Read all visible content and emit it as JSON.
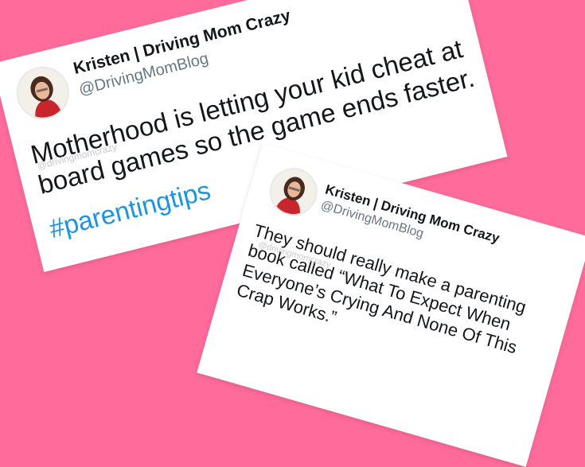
{
  "background_color": "#ff6b9b",
  "tweets": [
    {
      "display_name": "Kristen | Driving Mom Crazy",
      "handle": "@DrivingMomBlog",
      "text_line1": "Motherhood is letting your kid cheat at",
      "text_line2": "board games so the game ends faster.",
      "hashtag": "#parentingtips",
      "watermark": "@drivingmomcrazy",
      "avatar_icon": "woman-red-shirt-avatar"
    },
    {
      "display_name": "Kristen | Driving Mom Crazy",
      "handle": "@DrivingMomBlog",
      "text_line1": "They should really make a parenting",
      "text_line2": "book called “What To Expect When",
      "text_line3": "Everyone’s Crying And None Of This",
      "text_line4": "Crap Works.”",
      "watermark": "@drivingmomcrazy",
      "avatar_icon": "woman-red-shirt-avatar"
    }
  ],
  "colors": {
    "hashtag": "#1b95e0",
    "handle": "#657786",
    "text": "#14171a"
  }
}
